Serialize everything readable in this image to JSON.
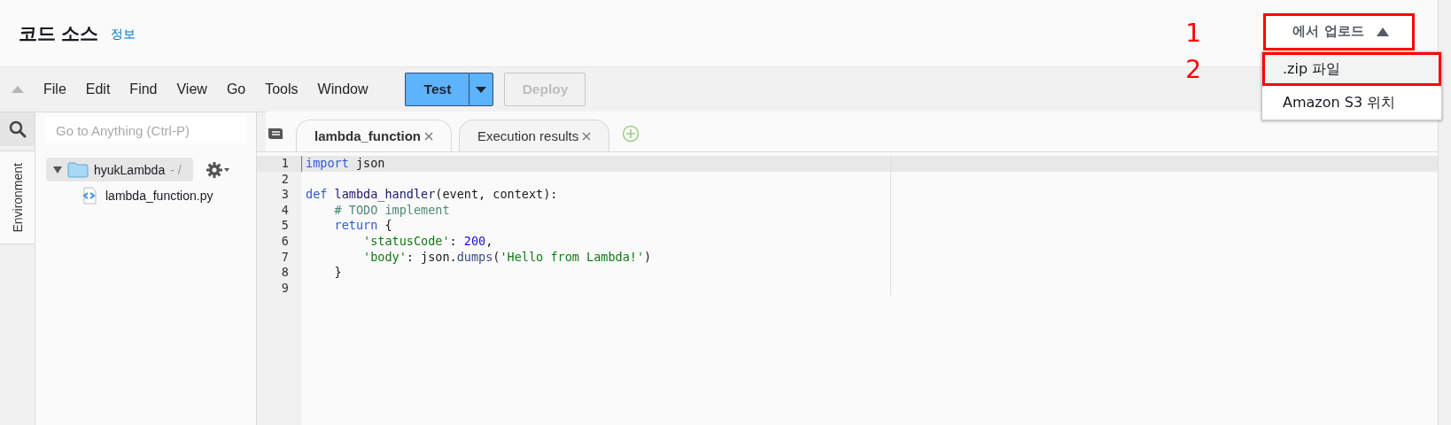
{
  "header": {
    "title": "코드 소스",
    "info_link": "정보"
  },
  "upload": {
    "button": "에서 업로드",
    "expanded": true,
    "menu": [
      {
        "label": ".zip 파일",
        "selected": true
      },
      {
        "label": "Amazon S3 위치",
        "selected": false
      }
    ]
  },
  "annotations": [
    {
      "label": "1",
      "kind": "button"
    },
    {
      "label": "2",
      "kind": "menu_item"
    }
  ],
  "toolbar": {
    "menus": [
      "File",
      "Edit",
      "Find",
      "View",
      "Go",
      "Tools",
      "Window"
    ],
    "test_button": "Test",
    "deploy_button": {
      "label": "Deploy",
      "disabled": true
    }
  },
  "search": {
    "placeholder": "Go to Anything (Ctrl-P)"
  },
  "side_tab": "Environment",
  "tree": [
    {
      "name": "hyukLambda",
      "suffix": "- /",
      "kind": "folder",
      "expanded": true,
      "selected": true,
      "children": [
        {
          "name": "lambda_function.py",
          "kind": "file"
        }
      ]
    }
  ],
  "tabs": [
    {
      "label": "lambda_function",
      "selected": true
    },
    {
      "label": "Execution results",
      "selected": false
    }
  ],
  "code": {
    "lines": [
      {
        "number": "1",
        "active": true,
        "tokens": [
          {
            "text": "import",
            "kind": "keyword"
          },
          {
            "text": " json",
            "kind": "plain"
          }
        ]
      },
      {
        "number": "2",
        "active": false
      },
      {
        "number": "3",
        "active": false,
        "tokens": [
          {
            "text": "def ",
            "kind": "keyword"
          },
          {
            "text": "lambda_handler",
            "kind": "function"
          },
          {
            "text": "(event, context):",
            "kind": "plain"
          }
        ]
      },
      {
        "number": "4",
        "active": false,
        "tokens": [
          {
            "text": "    # TODO implement",
            "kind": "comment"
          }
        ]
      },
      {
        "number": "5",
        "active": false,
        "tokens": [
          {
            "text": "    return",
            "kind": "keyword"
          },
          {
            "text": " {",
            "kind": "plain"
          }
        ]
      },
      {
        "number": "6",
        "active": false,
        "tokens": [
          {
            "text": "        'statusCode'",
            "kind": "string"
          },
          {
            "text": ": ",
            "kind": "plain"
          },
          {
            "text": "200",
            "kind": "number"
          },
          {
            "text": ",",
            "kind": "plain"
          }
        ]
      },
      {
        "number": "7",
        "active": false,
        "tokens": [
          {
            "text": "        'body'",
            "kind": "string"
          },
          {
            "text": ": json.",
            "kind": "plain"
          },
          {
            "text": "dumps",
            "kind": "method"
          },
          {
            "text": "(",
            "kind": "plain"
          },
          {
            "text": "'Hello from Lambda!'",
            "kind": "string"
          },
          {
            "text": ")",
            "kind": "plain"
          }
        ]
      },
      {
        "number": "8",
        "active": false,
        "tokens": [
          {
            "text": "    }",
            "kind": "plain"
          }
        ]
      },
      {
        "number": "9",
        "active": false
      }
    ]
  }
}
